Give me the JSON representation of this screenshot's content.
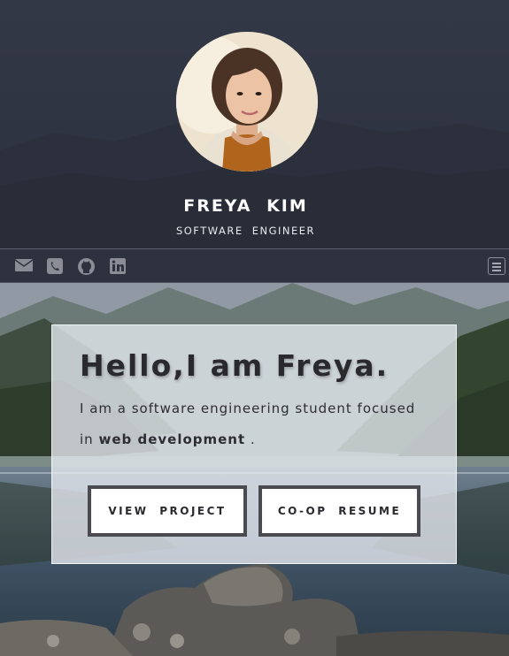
{
  "profile": {
    "name": "FREYA  KIM",
    "title": "SOFTWARE  ENGINEER"
  },
  "nav": {
    "icons": [
      "envelope-icon",
      "phone-icon",
      "github-icon",
      "linkedin-icon"
    ],
    "menu_icon": "hamburger-menu-icon"
  },
  "hero": {
    "greeting": "Hello,I am Freya.",
    "intro_part1": "I am a software engineering student focused in",
    "intro_highlight": "web development",
    "intro_end": ".",
    "buttons": {
      "project": "VIEW  PROJECT",
      "resume": "CO-OP  RESUME"
    }
  },
  "colors": {
    "header_bg": "#2f3442",
    "nav_icon": "#8a8d96",
    "card_bg": "#e8ecf2",
    "button_border": "#4a4a50",
    "text_dark": "#2a2a2e"
  }
}
